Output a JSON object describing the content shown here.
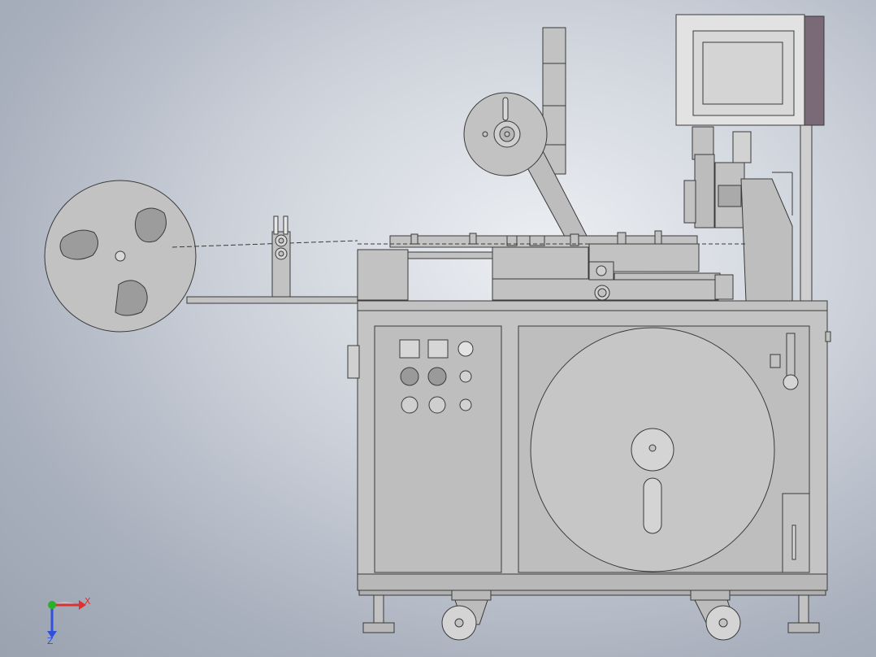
{
  "view": {
    "background_center": "#eceef2",
    "background_edge": "#9aa2b0"
  },
  "model": {
    "body_color": "#c2c2c2",
    "body_shade": "#b2b2b2",
    "edge_color": "#3a3a3a",
    "hmi_frame_color": "#e2e2e2",
    "hmi_side_color": "#7a6a78",
    "hmi_screen_color": "#d4d4d4"
  },
  "triad": {
    "x_label": "X",
    "z_label": "Z",
    "x_color": "#e03030",
    "y_color": "#2bb02b",
    "z_color": "#3050e0"
  }
}
